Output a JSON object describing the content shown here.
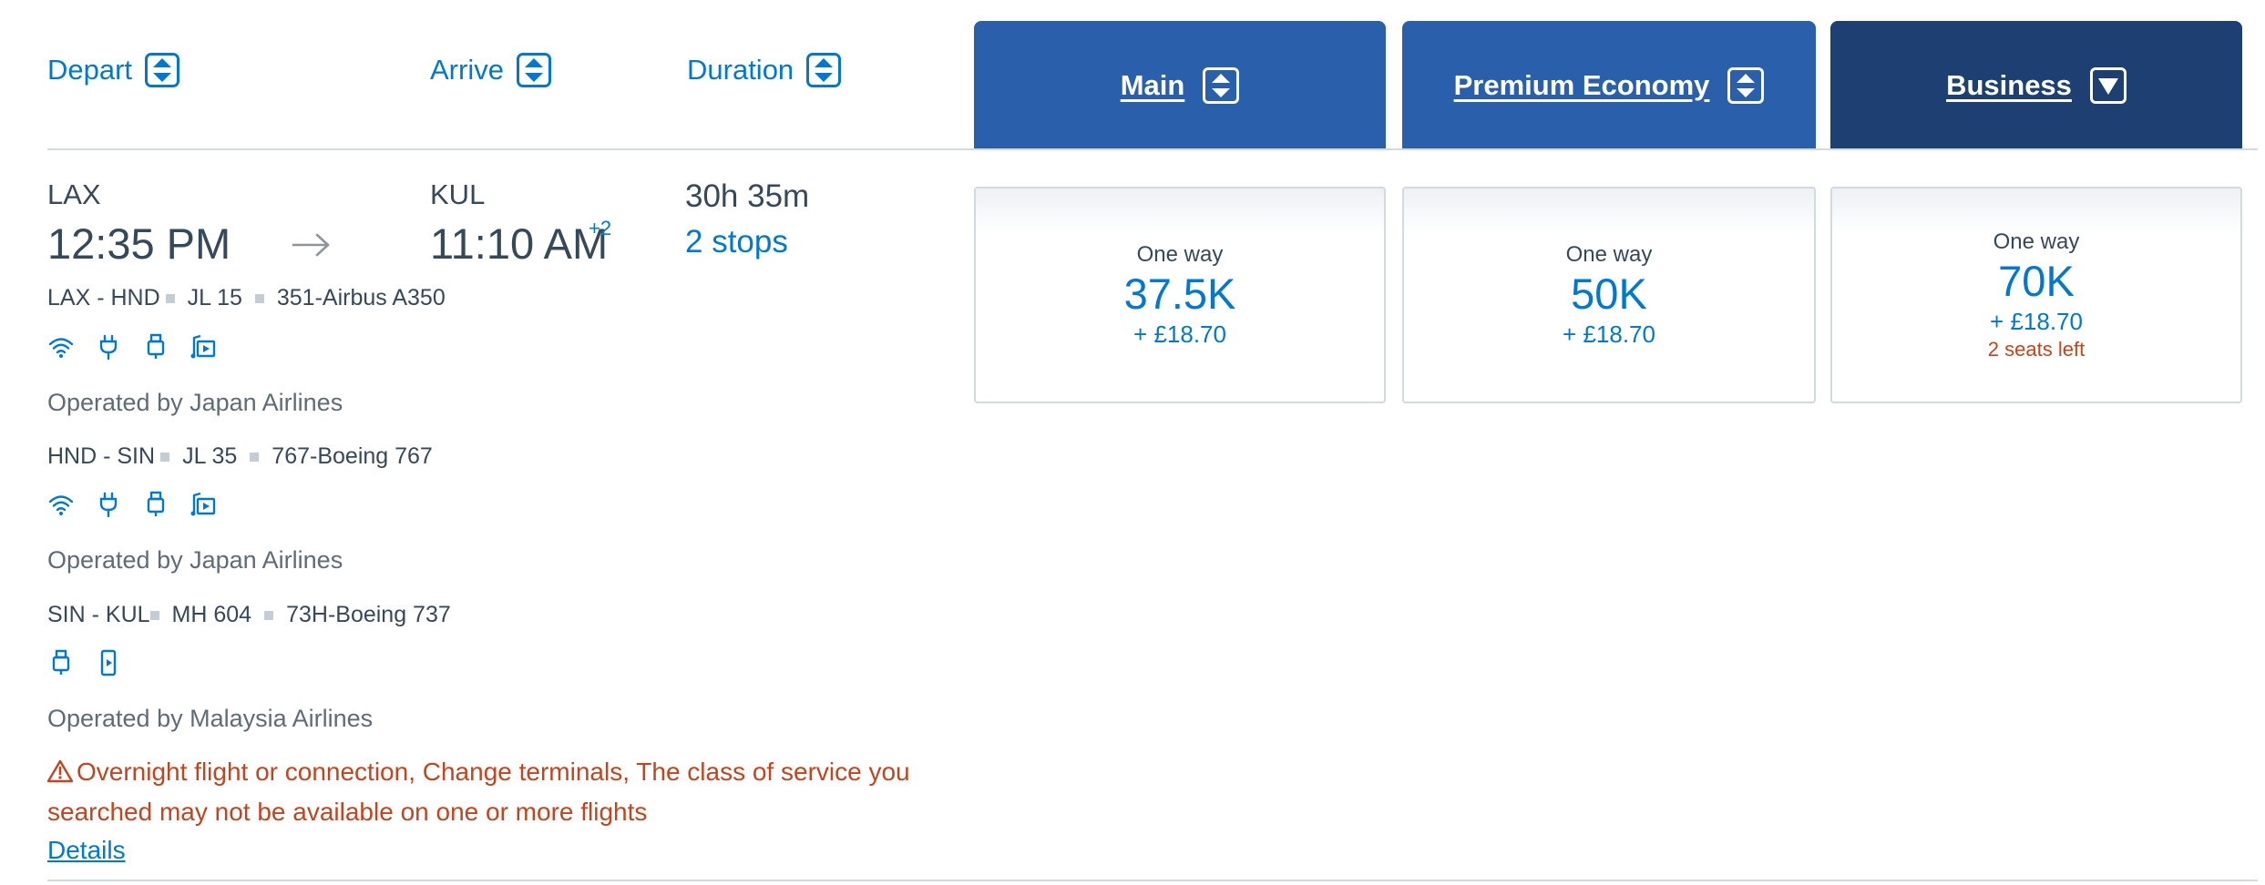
{
  "headers": {
    "depart": "Depart",
    "arrive": "Arrive",
    "duration": "Duration"
  },
  "cabins": [
    {
      "label": "Main",
      "sort_icon": "sort-updown-icon"
    },
    {
      "label": "Premium Economy",
      "sort_icon": "sort-updown-icon"
    },
    {
      "label": "Business",
      "sort_icon": "sort-down-icon",
      "active": true
    }
  ],
  "flight": {
    "origin": "LAX",
    "depart_time": "12:35 PM",
    "destination": "KUL",
    "arrive_time": "11:10 AM",
    "arrive_day_offset": "+2",
    "duration": "30h 35m",
    "stops": "2 stops",
    "segments": [
      {
        "route": "LAX - HND",
        "flight": "JL 15",
        "aircraft": "351-Airbus A350",
        "amenities": [
          "wifi-icon",
          "power-plug-icon",
          "usb-icon",
          "entertainment-icon"
        ],
        "operated_by": "Operated by Japan Airlines"
      },
      {
        "route": "HND - SIN",
        "flight": "JL 35",
        "aircraft": "767-Boeing 767",
        "amenities": [
          "wifi-icon",
          "power-plug-icon",
          "usb-icon",
          "entertainment-icon"
        ],
        "operated_by": "Operated by Japan Airlines"
      },
      {
        "route": "SIN - KUL",
        "flight": "MH 604",
        "aircraft": "73H-Boeing 737",
        "amenities": [
          "usb-icon",
          "mobile-entertainment-icon"
        ],
        "operated_by": "Operated by Malaysia Airlines"
      }
    ],
    "warning": "Overnight flight or connection, Change terminals, The class of service you searched may not be available on one or more flights",
    "details_link": "Details"
  },
  "fares": [
    {
      "cabin": "Main",
      "label": "One way",
      "miles": "37.5K",
      "fee": "+ £18.70"
    },
    {
      "cabin": "Premium Economy",
      "label": "One way",
      "miles": "50K",
      "fee": "+ £18.70"
    },
    {
      "cabin": "Business",
      "label": "One way",
      "miles": "70K",
      "fee": "+ £18.70",
      "seats_left": "2 seats left"
    }
  ],
  "colors": {
    "link_blue": "#0078d2",
    "tab_blue": "#2a5fab",
    "tab_active": "#1d3f72",
    "text": "#36495a",
    "warning": "#c4441d",
    "rule": "#d0dae0"
  }
}
